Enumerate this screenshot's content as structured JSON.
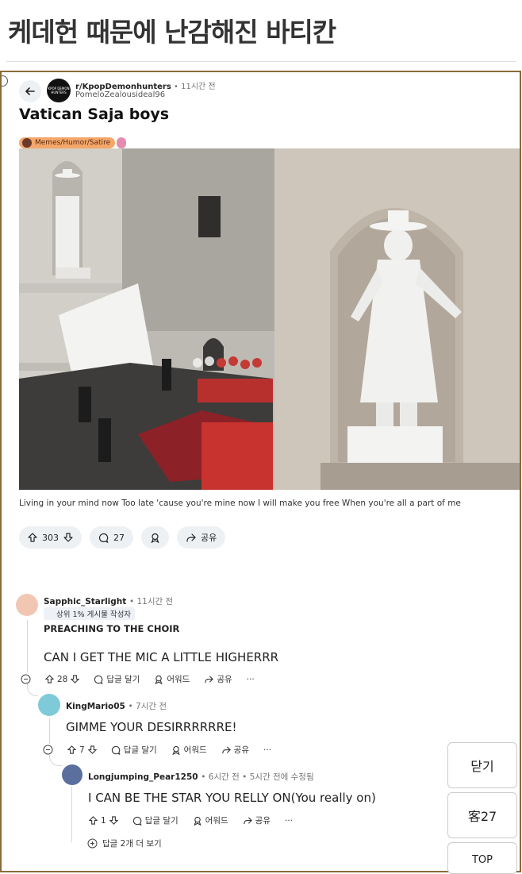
{
  "page": {
    "title": "케데헌 때문에 난감해진 바티칸"
  },
  "post": {
    "subreddit": "r/KpopDemonhunters",
    "time": "• 11시간 전",
    "username": "PomeloZealousideal96",
    "avatar_text": "KPOP DEMON HUNTERS",
    "title": "Vatican Saja boys",
    "flair": "Memes/Humor/Satire",
    "body": "Living in your mind now Too late 'cause you're mine now I will make you free When you're all a part of me",
    "votes": "303",
    "comments": "27",
    "share_label": "공유"
  },
  "comments": [
    {
      "username": "Sapphic_Starlight",
      "time": "• 11시간 전",
      "badge": "상위 1% 게시물 작성자",
      "heading": "PREACHING TO THE CHOIR",
      "text": "CAN I GET THE MIC A LITTLE HIGHERRR",
      "votes": "28",
      "reply_label": "답글 달기",
      "award_label": "어워드",
      "share_label": "공유",
      "more": "···"
    },
    {
      "username": "KingMario05",
      "time": "• 7시간 전",
      "text": "GIMME YOUR DESIRRRRRRE!",
      "votes": "7",
      "reply_label": "답글 달기",
      "award_label": "어워드",
      "share_label": "공유",
      "more": "···"
    },
    {
      "username": "Longjumping_Pear1250",
      "time": "• 6시간 전 • 5시간 전에 수정됨",
      "text": "I CAN BE THE STAR YOU RELLY ON(You really on)",
      "votes": "1",
      "reply_label": "답글 달기",
      "award_label": "어워드",
      "share_label": "공유",
      "more": "···"
    }
  ],
  "more_replies": "답글 2개 더 보기",
  "side_buttons": {
    "close": "닫기",
    "guest": "客27",
    "top": "TOP"
  },
  "colors": {
    "frame": "#8a6a3a",
    "flair": "#f4a76a",
    "pill": "#eef1f3"
  }
}
